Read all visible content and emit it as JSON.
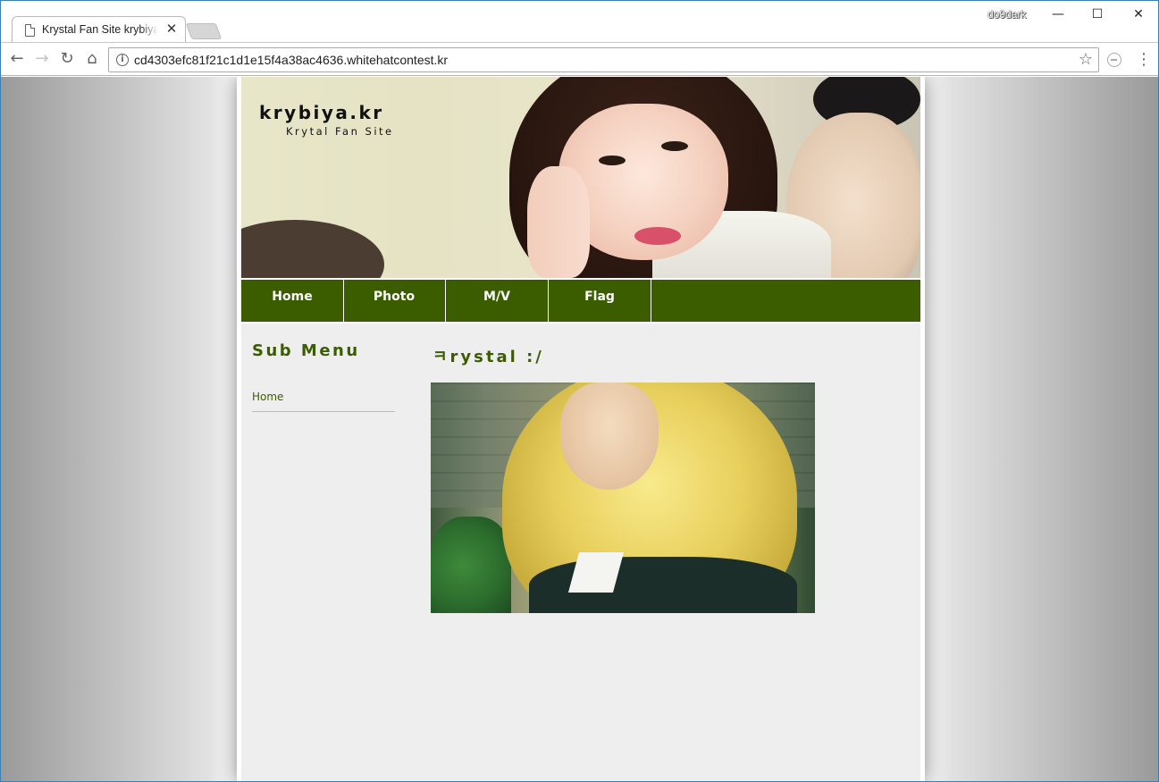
{
  "browser": {
    "tab_title": "Krystal Fan Site krybiya.kr",
    "tab_close": "✕",
    "profile_name": "do9dark",
    "url": "cd4303efc81f21c1d1e15f4a38ac4636.whitehatcontest.kr",
    "window_controls": {
      "minimize": "—",
      "maximize": "☐",
      "close": "✕"
    },
    "nav_icons": {
      "back": "←",
      "forward": "→",
      "reload": "↻",
      "home": "⌂",
      "star": "☆",
      "menu": "⋮",
      "info": "i"
    }
  },
  "site": {
    "title": "krybiya.kr",
    "subtitle": "Krytal Fan Site",
    "nav": [
      {
        "label": "Home"
      },
      {
        "label": "Photo"
      },
      {
        "label": "M/V"
      },
      {
        "label": "Flag"
      }
    ],
    "sidebar": {
      "title": "Sub Menu",
      "items": [
        {
          "label": "Home"
        }
      ]
    },
    "main": {
      "title": "ㅋrystal :/"
    }
  },
  "colors": {
    "accent": "#3b5d00",
    "content_bg": "#eeeeee"
  }
}
